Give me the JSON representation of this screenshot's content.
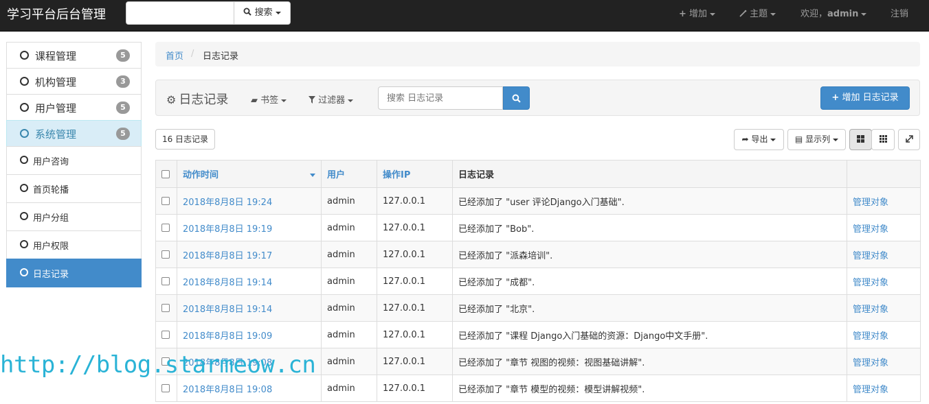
{
  "navbar": {
    "brand": "学习平台后台管理",
    "search_button": "搜索",
    "add_label": "增加",
    "theme_label": "主题",
    "welcome_prefix": "欢迎，",
    "username": "admin",
    "logout_label": "注销"
  },
  "sidebar": {
    "menus": [
      {
        "label": "课程管理",
        "badge": "5"
      },
      {
        "label": "机构管理",
        "badge": "3"
      },
      {
        "label": "用户管理",
        "badge": "5"
      },
      {
        "label": "系统管理",
        "badge": "5"
      }
    ],
    "submenus": [
      {
        "label": "用户咨询"
      },
      {
        "label": "首页轮播"
      },
      {
        "label": "用户分组"
      },
      {
        "label": "用户权限"
      },
      {
        "label": "日志记录"
      }
    ]
  },
  "breadcrumb": {
    "home": "首页",
    "separator": "/",
    "current": "日志记录"
  },
  "toolbar": {
    "title": "日志记录",
    "bookmarks_label": "书签",
    "filters_label": "过滤器",
    "search_placeholder": "搜索 日志记录",
    "add_button": "增加 日志记录"
  },
  "list": {
    "count_label": "16 日志记录",
    "export_label": "导出",
    "columns_label": "显示列"
  },
  "table": {
    "headers": [
      "动作时间",
      "用户",
      "操作IP",
      "日志记录"
    ],
    "rows": [
      {
        "time": "2018年8月8日 19:24",
        "user": "admin",
        "ip": "127.0.0.1",
        "log": "已经添加了 \"user 评论Django入门基础\".",
        "action": "管理对象"
      },
      {
        "time": "2018年8月8日 19:19",
        "user": "admin",
        "ip": "127.0.0.1",
        "log": "已经添加了 \"Bob\".",
        "action": "管理对象"
      },
      {
        "time": "2018年8月8日 19:17",
        "user": "admin",
        "ip": "127.0.0.1",
        "log": "已经添加了 \"派森培训\".",
        "action": "管理对象"
      },
      {
        "time": "2018年8月8日 19:14",
        "user": "admin",
        "ip": "127.0.0.1",
        "log": "已经添加了 \"成都\".",
        "action": "管理对象"
      },
      {
        "time": "2018年8月8日 19:14",
        "user": "admin",
        "ip": "127.0.0.1",
        "log": "已经添加了 \"北京\".",
        "action": "管理对象"
      },
      {
        "time": "2018年8月8日 19:09",
        "user": "admin",
        "ip": "127.0.0.1",
        "log": "已经添加了 \"课程 Django入门基础的资源：Django中文手册\".",
        "action": "管理对象"
      },
      {
        "time": "2018年8月8日 19:08",
        "user": "admin",
        "ip": "127.0.0.1",
        "log": "已经添加了 \"章节 视图的视频：视图基础讲解\".",
        "action": "管理对象"
      },
      {
        "time": "2018年8月8日 19:08",
        "user": "admin",
        "ip": "127.0.0.1",
        "log": "已经添加了 \"章节 模型的视频：模型讲解视频\".",
        "action": "管理对象"
      }
    ]
  },
  "watermark": "http://blog.starmeow.cn",
  "colors": {
    "navbar_bg": "#222222",
    "primary": "#428bca",
    "active_bg": "#d9edf7",
    "watermark": "#2ab3d6"
  }
}
